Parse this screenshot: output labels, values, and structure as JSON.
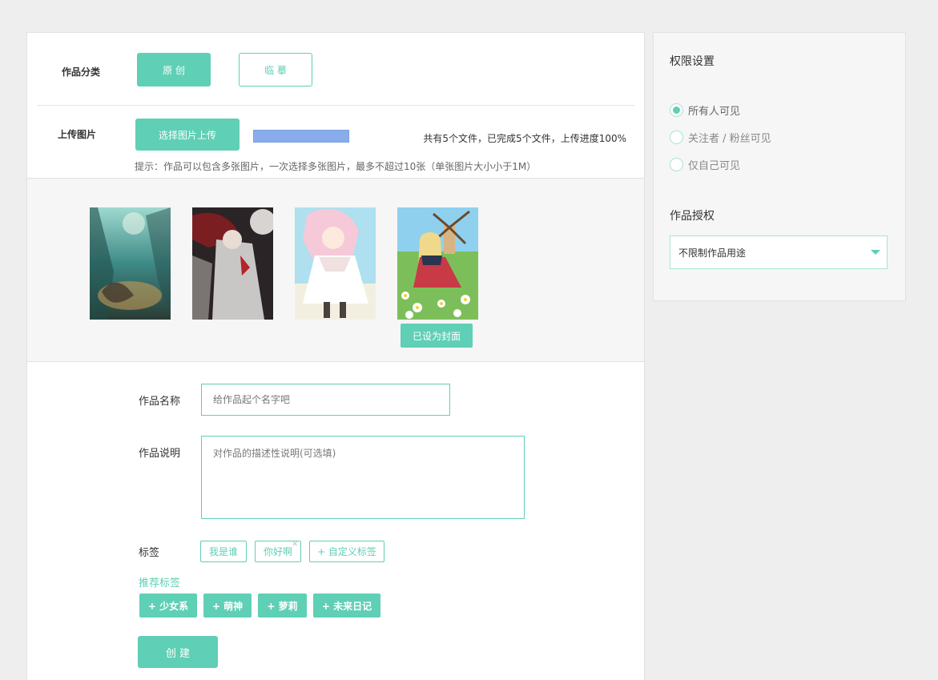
{
  "category": {
    "label": "作品分类",
    "options": [
      "原 创",
      "临 摹"
    ],
    "selected": "原 创"
  },
  "upload": {
    "label": "上传图片",
    "button": "选择图片上传",
    "progress": 1.0,
    "status": "共有5个文件，已完成5个文件，上传进度100%",
    "hint": "提示：作品可以包含多张图片，一次选择多张图片，最多不超过10张（单张图片大小小于1M）"
  },
  "gallery": {
    "cover_label": "已设为封面"
  },
  "form": {
    "name_label": "作品名称",
    "name_placeholder": "给作品起个名字吧",
    "desc_label": "作品说明",
    "desc_placeholder": "对作品的描述性说明(可选填)",
    "tags_label": "标签",
    "tags": [
      "我是谁",
      "你好啊"
    ],
    "custom_tag": "+ 自定义标签",
    "rec_title": "推荐标签",
    "rec_tags": [
      "+ 少女系",
      "+ 萌神",
      "+ 萝莉",
      "+ 未来日记"
    ],
    "submit": "创 建"
  },
  "permissions": {
    "title": "权限设置",
    "options": [
      "所有人可见",
      "关注者 / 粉丝可见",
      "仅自己可见"
    ],
    "selected": "所有人可见",
    "license_title": "作品授权",
    "license_value": "不限制作品用途"
  },
  "colors": {
    "accent": "#5fcfb5",
    "progress": "#89acea",
    "background": "#eeeeee"
  }
}
